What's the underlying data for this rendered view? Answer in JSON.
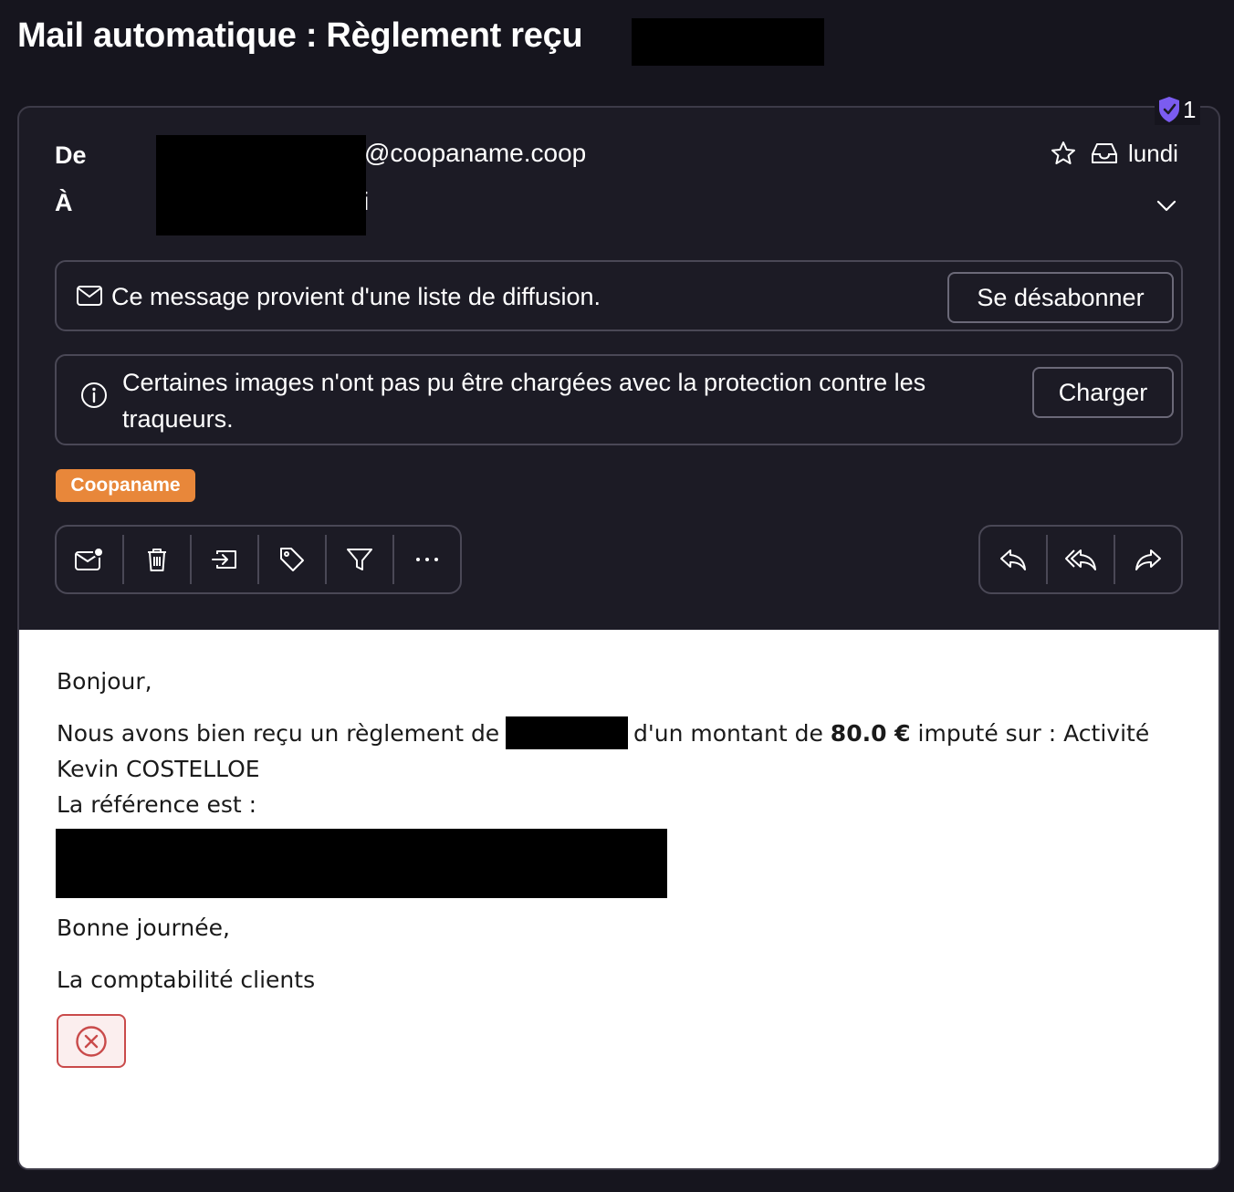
{
  "subject": "Mail automatique : Règlement reçu",
  "tracker_count": "1",
  "header": {
    "from_label": "De",
    "to_label": "À",
    "from_address_domain": "@coopaname.coop",
    "to_address_tail": "i",
    "date": "lundi"
  },
  "mailing_list_banner": {
    "text": "Ce message provient d'une liste de diffusion.",
    "unsubscribe_label": "Se désabonner"
  },
  "images_banner": {
    "text_line1": "Certaines images n'ont pas pu être chargées avec la protection contre les",
    "text_line2": "traqueurs.",
    "load_label": "Charger"
  },
  "label_tag": "Coopaname",
  "body": {
    "greeting": "Bonjour,",
    "line1_a": "Nous avons bien reçu un règlement de",
    "line1_b": "d'un montant de",
    "amount": "80.0 €",
    "line1_c": "imputé sur : Activité",
    "line2": "Kevin COSTELLOE",
    "line3": "La référence est :",
    "closing": "Bonne journée,",
    "signature": "La comptabilité clients"
  },
  "colors": {
    "background": "#16151e",
    "card": "#1c1b25",
    "tag": "#e8873a",
    "shield": "#7b5cf0",
    "error": "#c94a4a"
  }
}
